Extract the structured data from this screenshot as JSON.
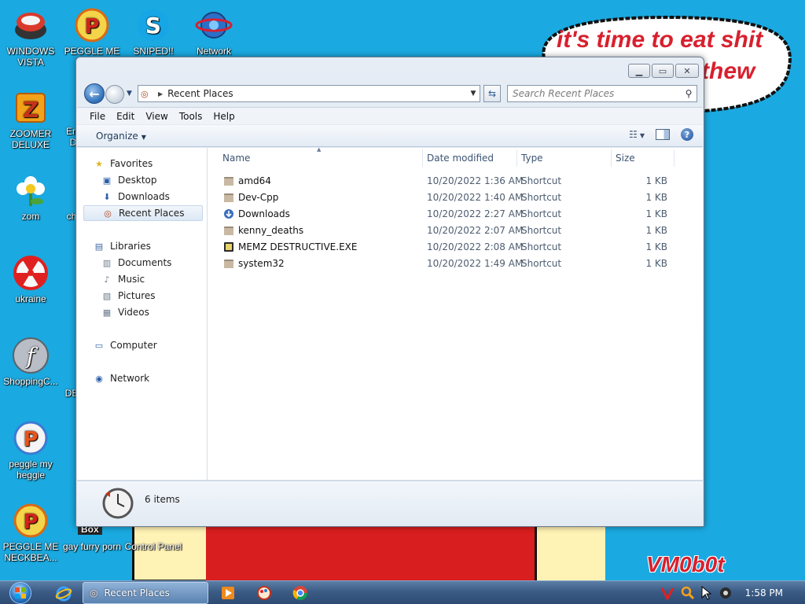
{
  "desktop": {
    "icons": [
      {
        "label": "WINDOWS VISTA"
      },
      {
        "label": "PEGGLE ME N..."
      },
      {
        "label": "SNIPED!! EPIC"
      },
      {
        "label": "Network"
      },
      {
        "label": "ZOOMER DELUXE"
      },
      {
        "label": "zom"
      },
      {
        "label": "ukraine"
      },
      {
        "label": "ShoppingC..."
      },
      {
        "label": "peggle my heggie"
      },
      {
        "label": "PEGGLE ME NECKBEA..."
      },
      {
        "label": "gay furry porn"
      },
      {
        "label": "Control Panel"
      }
    ],
    "partial_labels": [
      "Em",
      "D",
      "ch",
      "DE"
    ],
    "speech_line1": "it's time to eat shit",
    "speech_line2": "thew",
    "box_label": "Box",
    "signature": "VM0b0t"
  },
  "window": {
    "address_path": "Recent Places",
    "search_placeholder": "Search Recent Places",
    "menu": [
      "File",
      "Edit",
      "View",
      "Tools",
      "Help"
    ],
    "organize_label": "Organize",
    "nav": {
      "favorites": "Favorites",
      "desktop": "Desktop",
      "downloads": "Downloads",
      "recent_places": "Recent Places",
      "libraries": "Libraries",
      "documents": "Documents",
      "music": "Music",
      "pictures": "Pictures",
      "videos": "Videos",
      "computer": "Computer",
      "network": "Network"
    },
    "columns": {
      "name": "Name",
      "date": "Date modified",
      "type": "Type",
      "size": "Size"
    },
    "files": [
      {
        "name": "amd64",
        "date": "10/20/2022 1:36 AM",
        "type": "Shortcut",
        "size": "1 KB",
        "icon": "folder-shortcut-icon"
      },
      {
        "name": "Dev-Cpp",
        "date": "10/20/2022 1:40 AM",
        "type": "Shortcut",
        "size": "1 KB",
        "icon": "folder-shortcut-icon"
      },
      {
        "name": "Downloads",
        "date": "10/20/2022 2:27 AM",
        "type": "Shortcut",
        "size": "1 KB",
        "icon": "downloads-icon"
      },
      {
        "name": "kenny_deaths",
        "date": "10/20/2022 2:07 AM",
        "type": "Shortcut",
        "size": "1 KB",
        "icon": "folder-shortcut-icon"
      },
      {
        "name": "MEMZ DESTRUCTIVE.EXE",
        "date": "10/20/2022 2:08 AM",
        "type": "Shortcut",
        "size": "1 KB",
        "icon": "exe-icon"
      },
      {
        "name": "system32",
        "date": "10/20/2022 1:49 AM",
        "type": "Shortcut",
        "size": "1 KB",
        "icon": "folder-shortcut-icon"
      }
    ],
    "status_count": "6 items"
  },
  "taskbar": {
    "active_window": "Recent Places",
    "clock": "1:58 PM"
  },
  "colors": {
    "desktop_bg": "#1aa9e0",
    "speech_text": "#d8202e",
    "taskbar": "#3b5c86"
  }
}
